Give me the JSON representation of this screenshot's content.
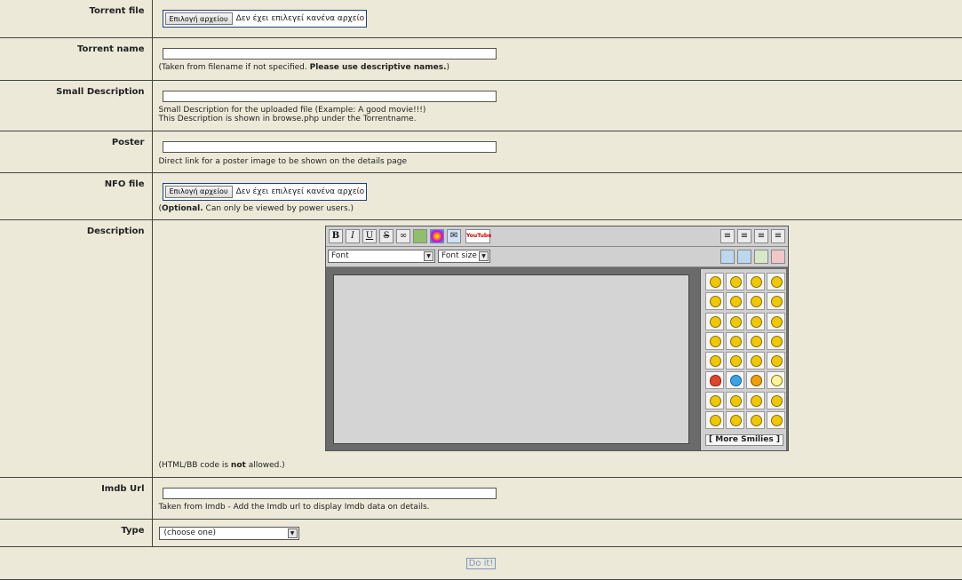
{
  "rows": {
    "torrent_file": {
      "label": "Torrent file",
      "button": "Επιλογή αρχείου",
      "status": "Δεν έχει επιλεγεί κανένα αρχείο"
    },
    "torrent_name": {
      "label": "Torrent name",
      "hint_prefix": "(Taken from filename if not specified. ",
      "hint_bold": "Please use descriptive names.",
      "hint_suffix": ")"
    },
    "small_description": {
      "label": "Small Description",
      "hint_line1": "Small Description for the uploaded file (Example: A good movie!!!)",
      "hint_line2": "This Description is shown in browse.php under the Torrentname."
    },
    "poster": {
      "label": "Poster",
      "hint": "Direct link for a poster image to be shown on the details page"
    },
    "nfo_file": {
      "label": "NFO file",
      "button": "Επιλογή αρχείου",
      "status": "Δεν έχει επιλεγεί κανένα αρχείο",
      "hint_prefix": "(",
      "hint_bold": "Optional.",
      "hint_suffix": " Can only be viewed by power users.)"
    },
    "description": {
      "label": "Description",
      "hint_prefix": "(HTML/BB code is ",
      "hint_bold": "not",
      "hint_suffix": " allowed.)"
    },
    "imdb": {
      "label": "Imdb Url",
      "hint": "Taken from Imdb - Add the Imdb url to display Imdb data on details."
    },
    "type": {
      "label": "Type",
      "selected": "(choose one)"
    }
  },
  "editor": {
    "toolbar_buttons": [
      "B",
      "I",
      "U",
      "S"
    ],
    "youtube_label": "YouTube",
    "font_select": "Font",
    "size_select": "Font size",
    "more_smilies": "[ More Smilies ]",
    "smilies": [
      "smile",
      "grin",
      "laugh",
      "rofl",
      "wink",
      "happy",
      "tongue",
      "confused",
      "sad",
      "shocked",
      "surprised",
      "sleepy",
      "angel",
      "cool-eyes",
      "neutral",
      "sunglasses",
      "wave",
      "tongue-out",
      "happy2",
      "unsure",
      "heart",
      "question",
      "warning",
      "idea",
      "arrow-right",
      "arrow-left",
      "blush",
      "think",
      "smirk",
      "grin2",
      "worried",
      "silly"
    ]
  },
  "submit": {
    "label": "Do it!"
  }
}
